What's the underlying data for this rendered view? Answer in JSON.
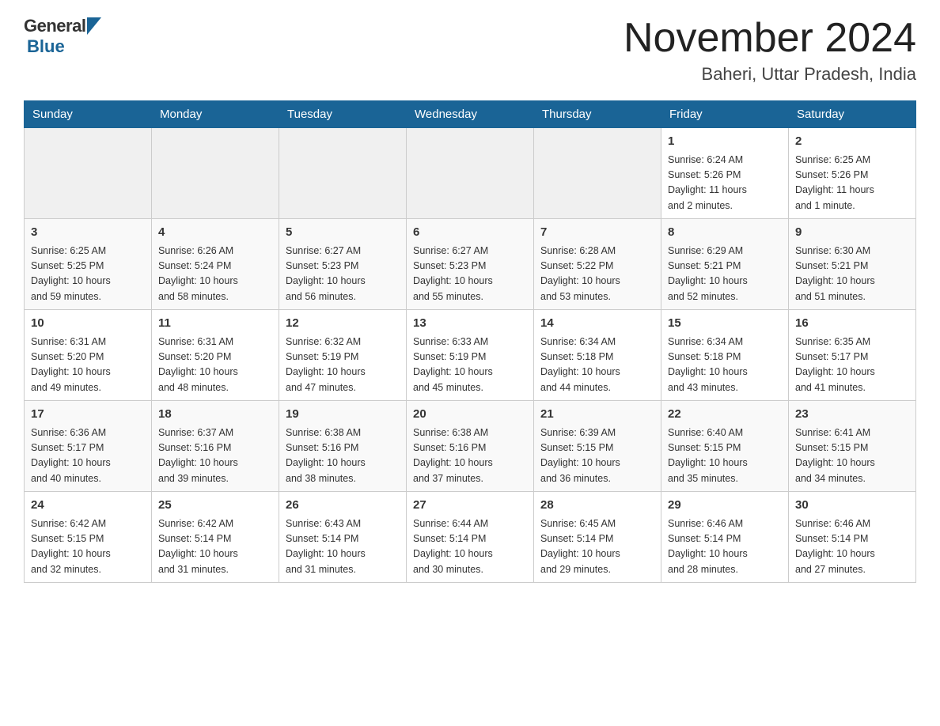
{
  "header": {
    "logo_general": "General",
    "logo_blue": "Blue",
    "month_title": "November 2024",
    "location": "Baheri, Uttar Pradesh, India"
  },
  "calendar": {
    "days_of_week": [
      "Sunday",
      "Monday",
      "Tuesday",
      "Wednesday",
      "Thursday",
      "Friday",
      "Saturday"
    ],
    "weeks": [
      [
        {
          "day": "",
          "info": ""
        },
        {
          "day": "",
          "info": ""
        },
        {
          "day": "",
          "info": ""
        },
        {
          "day": "",
          "info": ""
        },
        {
          "day": "",
          "info": ""
        },
        {
          "day": "1",
          "info": "Sunrise: 6:24 AM\nSunset: 5:26 PM\nDaylight: 11 hours\nand 2 minutes."
        },
        {
          "day": "2",
          "info": "Sunrise: 6:25 AM\nSunset: 5:26 PM\nDaylight: 11 hours\nand 1 minute."
        }
      ],
      [
        {
          "day": "3",
          "info": "Sunrise: 6:25 AM\nSunset: 5:25 PM\nDaylight: 10 hours\nand 59 minutes."
        },
        {
          "day": "4",
          "info": "Sunrise: 6:26 AM\nSunset: 5:24 PM\nDaylight: 10 hours\nand 58 minutes."
        },
        {
          "day": "5",
          "info": "Sunrise: 6:27 AM\nSunset: 5:23 PM\nDaylight: 10 hours\nand 56 minutes."
        },
        {
          "day": "6",
          "info": "Sunrise: 6:27 AM\nSunset: 5:23 PM\nDaylight: 10 hours\nand 55 minutes."
        },
        {
          "day": "7",
          "info": "Sunrise: 6:28 AM\nSunset: 5:22 PM\nDaylight: 10 hours\nand 53 minutes."
        },
        {
          "day": "8",
          "info": "Sunrise: 6:29 AM\nSunset: 5:21 PM\nDaylight: 10 hours\nand 52 minutes."
        },
        {
          "day": "9",
          "info": "Sunrise: 6:30 AM\nSunset: 5:21 PM\nDaylight: 10 hours\nand 51 minutes."
        }
      ],
      [
        {
          "day": "10",
          "info": "Sunrise: 6:31 AM\nSunset: 5:20 PM\nDaylight: 10 hours\nand 49 minutes."
        },
        {
          "day": "11",
          "info": "Sunrise: 6:31 AM\nSunset: 5:20 PM\nDaylight: 10 hours\nand 48 minutes."
        },
        {
          "day": "12",
          "info": "Sunrise: 6:32 AM\nSunset: 5:19 PM\nDaylight: 10 hours\nand 47 minutes."
        },
        {
          "day": "13",
          "info": "Sunrise: 6:33 AM\nSunset: 5:19 PM\nDaylight: 10 hours\nand 45 minutes."
        },
        {
          "day": "14",
          "info": "Sunrise: 6:34 AM\nSunset: 5:18 PM\nDaylight: 10 hours\nand 44 minutes."
        },
        {
          "day": "15",
          "info": "Sunrise: 6:34 AM\nSunset: 5:18 PM\nDaylight: 10 hours\nand 43 minutes."
        },
        {
          "day": "16",
          "info": "Sunrise: 6:35 AM\nSunset: 5:17 PM\nDaylight: 10 hours\nand 41 minutes."
        }
      ],
      [
        {
          "day": "17",
          "info": "Sunrise: 6:36 AM\nSunset: 5:17 PM\nDaylight: 10 hours\nand 40 minutes."
        },
        {
          "day": "18",
          "info": "Sunrise: 6:37 AM\nSunset: 5:16 PM\nDaylight: 10 hours\nand 39 minutes."
        },
        {
          "day": "19",
          "info": "Sunrise: 6:38 AM\nSunset: 5:16 PM\nDaylight: 10 hours\nand 38 minutes."
        },
        {
          "day": "20",
          "info": "Sunrise: 6:38 AM\nSunset: 5:16 PM\nDaylight: 10 hours\nand 37 minutes."
        },
        {
          "day": "21",
          "info": "Sunrise: 6:39 AM\nSunset: 5:15 PM\nDaylight: 10 hours\nand 36 minutes."
        },
        {
          "day": "22",
          "info": "Sunrise: 6:40 AM\nSunset: 5:15 PM\nDaylight: 10 hours\nand 35 minutes."
        },
        {
          "day": "23",
          "info": "Sunrise: 6:41 AM\nSunset: 5:15 PM\nDaylight: 10 hours\nand 34 minutes."
        }
      ],
      [
        {
          "day": "24",
          "info": "Sunrise: 6:42 AM\nSunset: 5:15 PM\nDaylight: 10 hours\nand 32 minutes."
        },
        {
          "day": "25",
          "info": "Sunrise: 6:42 AM\nSunset: 5:14 PM\nDaylight: 10 hours\nand 31 minutes."
        },
        {
          "day": "26",
          "info": "Sunrise: 6:43 AM\nSunset: 5:14 PM\nDaylight: 10 hours\nand 31 minutes."
        },
        {
          "day": "27",
          "info": "Sunrise: 6:44 AM\nSunset: 5:14 PM\nDaylight: 10 hours\nand 30 minutes."
        },
        {
          "day": "28",
          "info": "Sunrise: 6:45 AM\nSunset: 5:14 PM\nDaylight: 10 hours\nand 29 minutes."
        },
        {
          "day": "29",
          "info": "Sunrise: 6:46 AM\nSunset: 5:14 PM\nDaylight: 10 hours\nand 28 minutes."
        },
        {
          "day": "30",
          "info": "Sunrise: 6:46 AM\nSunset: 5:14 PM\nDaylight: 10 hours\nand 27 minutes."
        }
      ]
    ]
  }
}
